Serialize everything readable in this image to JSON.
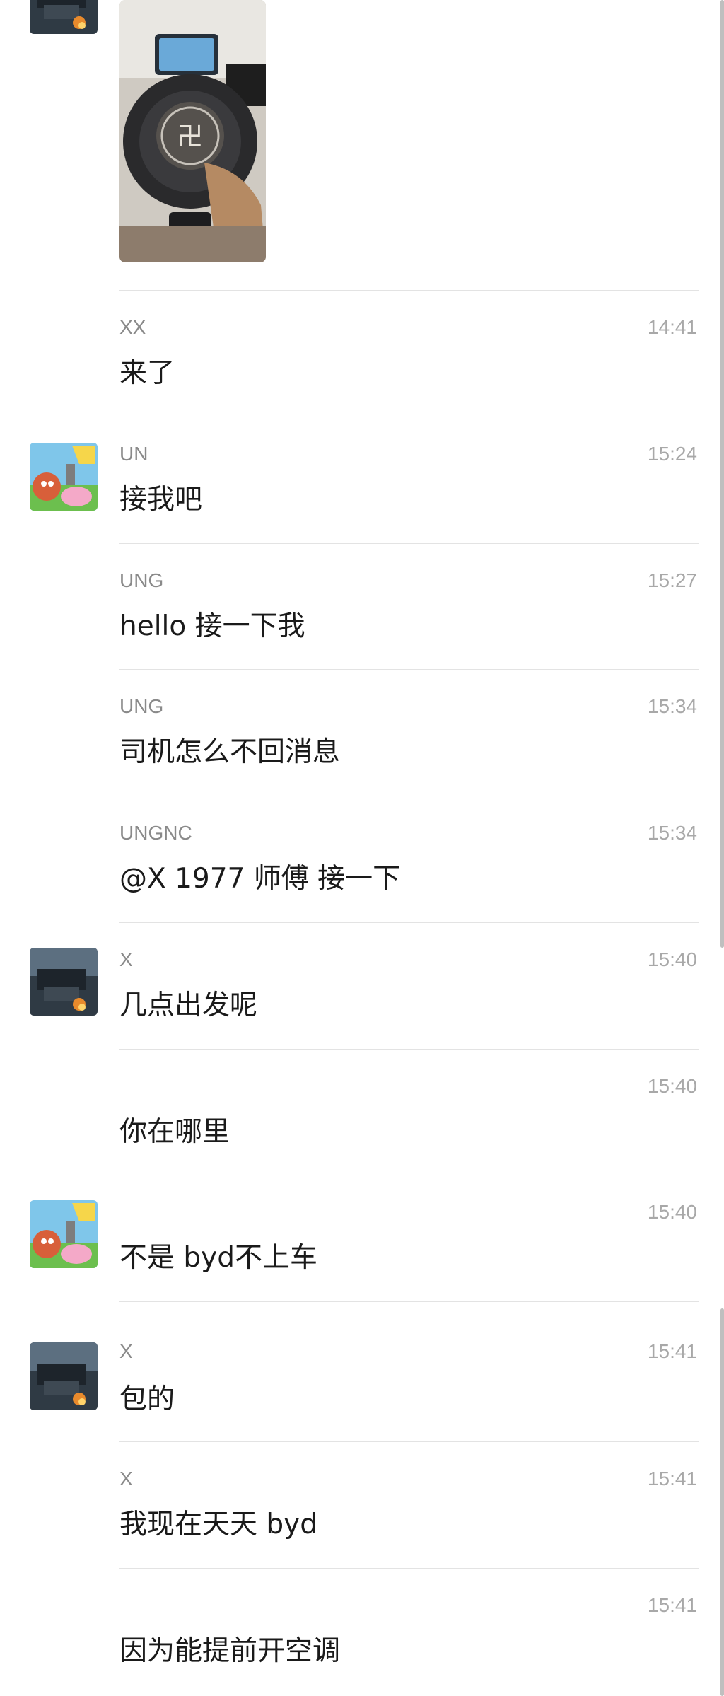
{
  "messages": [
    {
      "sender": "XX",
      "time": "14:41",
      "text": "来了",
      "avatar": "none"
    },
    {
      "sender": "UN",
      "time": "15:24",
      "text": "接我吧",
      "avatar": "cartoon"
    },
    {
      "sender": "UNG",
      "time": "15:27",
      "text": "hello 接一下我",
      "avatar": "none"
    },
    {
      "sender": "UNG",
      "time": "15:34",
      "text": "司机怎么不回消息",
      "avatar": "none"
    },
    {
      "sender": "UNGNC",
      "time": "15:34",
      "text": "@X 1977 师傅 接一下",
      "avatar": "none"
    },
    {
      "sender": "X",
      "time": "15:40",
      "text": "几点出发呢",
      "avatar": "car-photo"
    },
    {
      "sender": "",
      "time": "15:40",
      "text": "你在哪里",
      "avatar": "none"
    },
    {
      "sender": "",
      "time": "15:40",
      "text": "不是 byd不上车",
      "avatar": "cartoon"
    },
    {
      "sender": "X",
      "time": "15:41",
      "text": "包的",
      "avatar": "car-photo"
    },
    {
      "sender": "X",
      "time": "15:41",
      "text": "我现在天天 byd",
      "avatar": "none"
    },
    {
      "sender": "",
      "time": "15:41",
      "text": "因为能提前开空调",
      "avatar": "none"
    }
  ],
  "image_message": {
    "avatar": "car-photo",
    "image": "steering-wheel-photo"
  },
  "colors": {
    "background": "#ffffff",
    "text": "#1a1a1a",
    "sender": "#8a8a8a",
    "time": "#a8a8a8",
    "divider": "#e3e3e3"
  }
}
